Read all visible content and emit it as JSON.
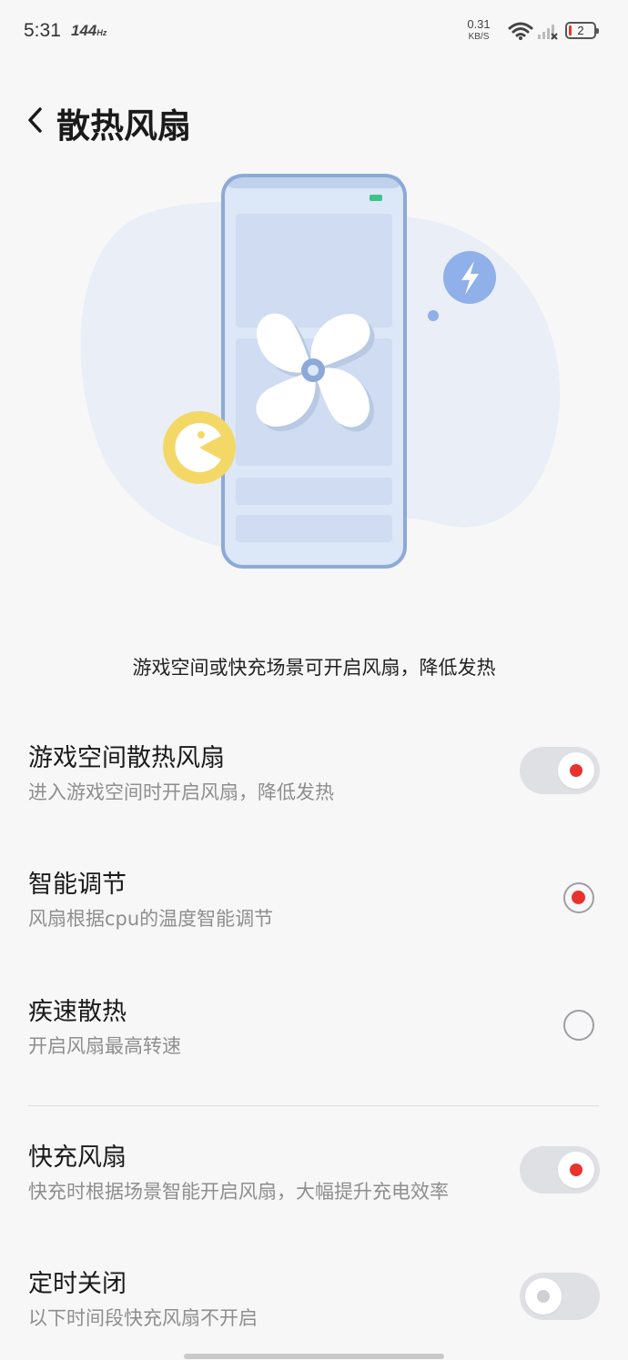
{
  "status_bar": {
    "time": "5:31",
    "refresh_rate": "144",
    "refresh_unit": "Hz",
    "net_speed": "0.31",
    "net_unit": "KB/S",
    "battery": "2"
  },
  "header": {
    "title": "散热风扇"
  },
  "description": "游戏空间或快充场景可开启风扇，降低发热",
  "settings": {
    "game_fan": {
      "title": "游戏空间散热风扇",
      "subtitle": "进入游戏空间时开启风扇，降低发热",
      "enabled": true
    },
    "smart_adjust": {
      "title": "智能调节",
      "subtitle": "风扇根据cpu的温度智能调节",
      "selected": true
    },
    "rapid_cooling": {
      "title": "疾速散热",
      "subtitle": "开启风扇最高转速",
      "selected": false
    },
    "fast_charge_fan": {
      "title": "快充风扇",
      "subtitle": "快充时根据场景智能开启风扇，大幅提升充电效率",
      "enabled": true
    },
    "timed_off": {
      "title": "定时关闭",
      "subtitle": "以下时间段快充风扇不开启",
      "enabled": false
    }
  },
  "colors": {
    "accent": "#e8332d",
    "toggle_track": "#dfe0e3",
    "phone_outline": "#8da9d8",
    "blob": "#e8eef8",
    "game_badge": "#f4d865",
    "bolt_badge": "#8fb0e8"
  },
  "icons": [
    "back-icon",
    "wifi-icon",
    "signal-icon",
    "battery-icon",
    "fan-icon",
    "game-icon",
    "lightning-icon"
  ]
}
